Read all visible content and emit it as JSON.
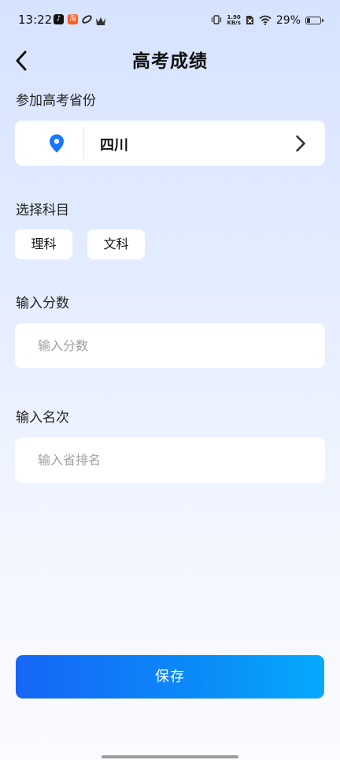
{
  "status_bar": {
    "time": "13:22",
    "net_speed_value": "1.90",
    "net_speed_unit": "KB/s",
    "battery_percent": "29%",
    "battery_level": 0.29,
    "icons": [
      "tiktok-icon",
      "taobao-icon",
      "link-app-icon",
      "crown-icon",
      "vibrate-icon",
      "no-sim-icon",
      "wifi-icon",
      "battery-icon"
    ]
  },
  "header": {
    "title": "高考成绩",
    "back_icon": "chevron-left-icon"
  },
  "province": {
    "label": "参加高考省份",
    "value": "四川",
    "icon": "location-pin-icon",
    "accent_color": "#1677ff"
  },
  "subject": {
    "label": "选择科目",
    "options": [
      "理科",
      "文科"
    ]
  },
  "score": {
    "label": "输入分数",
    "placeholder": "输入分数",
    "value": ""
  },
  "rank": {
    "label": "输入名次",
    "placeholder": "输入省排名",
    "value": ""
  },
  "save_button": {
    "label": "保存",
    "gradient_start": "#1666f6",
    "gradient_end": "#06a9fb"
  }
}
